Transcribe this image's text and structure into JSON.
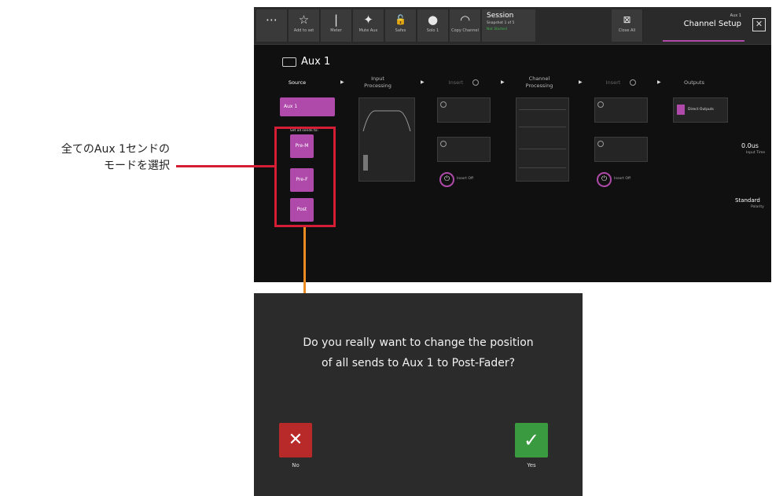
{
  "toolbar": {
    "items": [
      {
        "icon": "⋯",
        "label": ""
      },
      {
        "icon": "☆",
        "label": "Add to set"
      },
      {
        "icon": "|",
        "label": "Meter"
      },
      {
        "icon": "✦",
        "label": "Mute Aux"
      },
      {
        "icon": "🔓",
        "label": "Safes"
      },
      {
        "icon": "●",
        "label": "Solo 1"
      },
      {
        "icon": "◠",
        "label": "Copy Channel"
      }
    ],
    "session_title": "Session",
    "session_sub": "Snapshot 1 of 5",
    "session_status": "Not Started",
    "close_all_label": "Close All",
    "header_small": "Aux 1",
    "header_title": "Channel Setup",
    "close_icon": "✕"
  },
  "channel": {
    "name": "Aux 1",
    "sections": [
      "Source",
      "Input Processing",
      "Insert",
      "Channel Processing",
      "Insert",
      "Outputs"
    ],
    "source_button": "Aux 1",
    "set_all_label": "Set all sends to:",
    "modes": [
      "Pre-M",
      "Pre-F",
      "Post"
    ],
    "insert_off": "Insert Off",
    "input_time": "0.0us",
    "input_time_label": "Input Time",
    "polarity": "Standard",
    "polarity_label": "Polarity",
    "direct_outputs": "Direct Outputs"
  },
  "annotation": {
    "line1": "全てのAux 1センドの",
    "line2": "モードを選択"
  },
  "dialog": {
    "line1": "Do you really want to change the position",
    "line2": "of all sends to Aux 1 to Post-Fader?",
    "no_label": "No",
    "yes_label": "Yes",
    "no_icon": "✕",
    "yes_icon": "✓"
  },
  "colors": {
    "accent": "#b04aaa",
    "highlight": "#d41e36",
    "arrow": "#e98b22",
    "no": "#b82a2a",
    "yes": "#3a9a3f"
  }
}
